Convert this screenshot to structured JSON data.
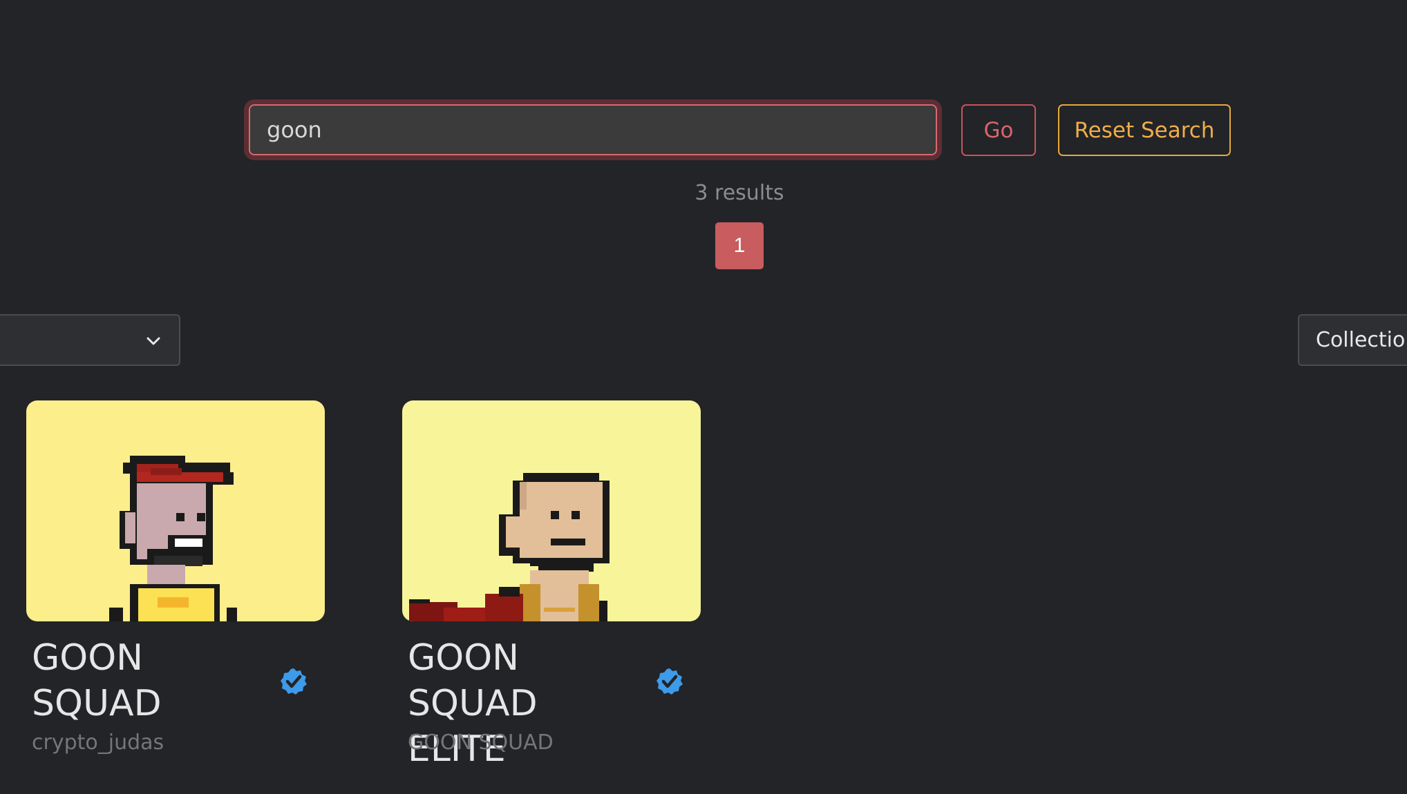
{
  "search": {
    "value": "goon"
  },
  "buttons": {
    "go_label": "Go",
    "reset_label": "Reset Search"
  },
  "results": {
    "count_text": "3 results",
    "pages": [
      "1"
    ],
    "current_page": "1"
  },
  "filters": {
    "collection_label": "Collection"
  },
  "icons": {
    "dropdown": "chevron-down-icon",
    "verified": "verified-badge-icon"
  },
  "colors": {
    "background": "#222428",
    "accent_red": "#c95c5f",
    "accent_orange": "#efae4a",
    "verified_blue": "#3d9be9"
  },
  "cards": [
    {
      "title_line1": "GOON",
      "title_line2": "SQUAD",
      "subtitle": "crypto_judas",
      "verified": true
    },
    {
      "title_line1": "GOON",
      "title_line2": "SQUAD ELITE",
      "subtitle": "GOON SQUAD",
      "verified": true
    }
  ]
}
